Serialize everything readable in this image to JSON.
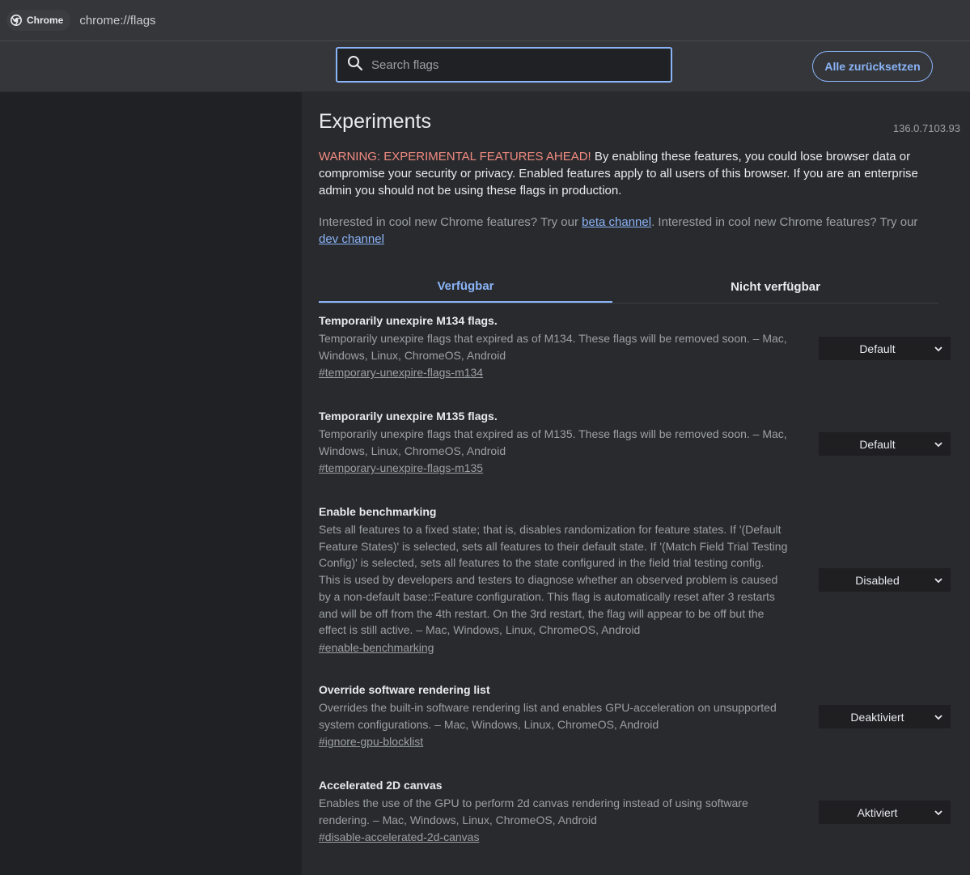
{
  "browser": {
    "chip_label": "Chrome",
    "url": "chrome://flags"
  },
  "header": {
    "search_placeholder": "Search flags",
    "reset_label": "Alle zurücksetzen"
  },
  "page": {
    "title": "Experiments",
    "version": "136.0.7103.93",
    "warning_label": "WARNING: EXPERIMENTAL FEATURES AHEAD!",
    "warning_text": " By enabling these features, you could lose browser data or compromise your security or privacy. Enabled features apply to all users of this browser. If you are an enterprise admin you should not be using these flags in production.",
    "interest_text_1": "Interested in cool new Chrome features? Try our ",
    "beta_link": "beta channel",
    "interest_text_2": ". Interested in cool new Chrome features? Try our ",
    "dev_link": "dev channel"
  },
  "tabs": [
    {
      "label": "Verfügbar",
      "active": true
    },
    {
      "label": "Nicht verfügbar",
      "active": false
    }
  ],
  "experiments": [
    {
      "title": "Temporarily unexpire M134 flags.",
      "description": "Temporarily unexpire flags that expired as of M134. These flags will be removed soon. – Mac, Windows, Linux, ChromeOS, Android",
      "link": "#temporary-unexpire-flags-m134",
      "value": "Default"
    },
    {
      "title": "Temporarily unexpire M135 flags.",
      "description": "Temporarily unexpire flags that expired as of M135. These flags will be removed soon. – Mac, Windows, Linux, ChromeOS, Android",
      "link": "#temporary-unexpire-flags-m135",
      "value": "Default"
    },
    {
      "title": "Enable benchmarking",
      "description": "Sets all features to a fixed state; that is, disables randomization for feature states. If '(Default Feature States)' is selected, sets all features to their default state. If '(Match Field Trial Testing Config)' is selected, sets all features to the state configured in the field trial testing config. This is used by developers and testers to diagnose whether an observed problem is caused by a non-default base::Feature configuration. This flag is automatically reset after 3 restarts and will be off from the 4th restart. On the 3rd restart, the flag will appear to be off but the effect is still active. – Mac, Windows, Linux, ChromeOS, Android",
      "link": "#enable-benchmarking",
      "value": "Disabled"
    },
    {
      "title": "Override software rendering list",
      "description": "Overrides the built-in software rendering list and enables GPU-acceleration on unsupported system configurations. – Mac, Windows, Linux, ChromeOS, Android",
      "link": "#ignore-gpu-blocklist",
      "value": "Deaktiviert"
    },
    {
      "title": "Accelerated 2D canvas",
      "description": "Enables the use of the GPU to perform 2d canvas rendering instead of using software rendering. – Mac, Windows, Linux, ChromeOS, Android",
      "link": "#disable-accelerated-2d-canvas",
      "value": "Aktiviert"
    }
  ],
  "colors": {
    "background": "#202124",
    "panel": "#292a2d",
    "accent": "#8ab4f8",
    "warning": "#f28b82"
  }
}
